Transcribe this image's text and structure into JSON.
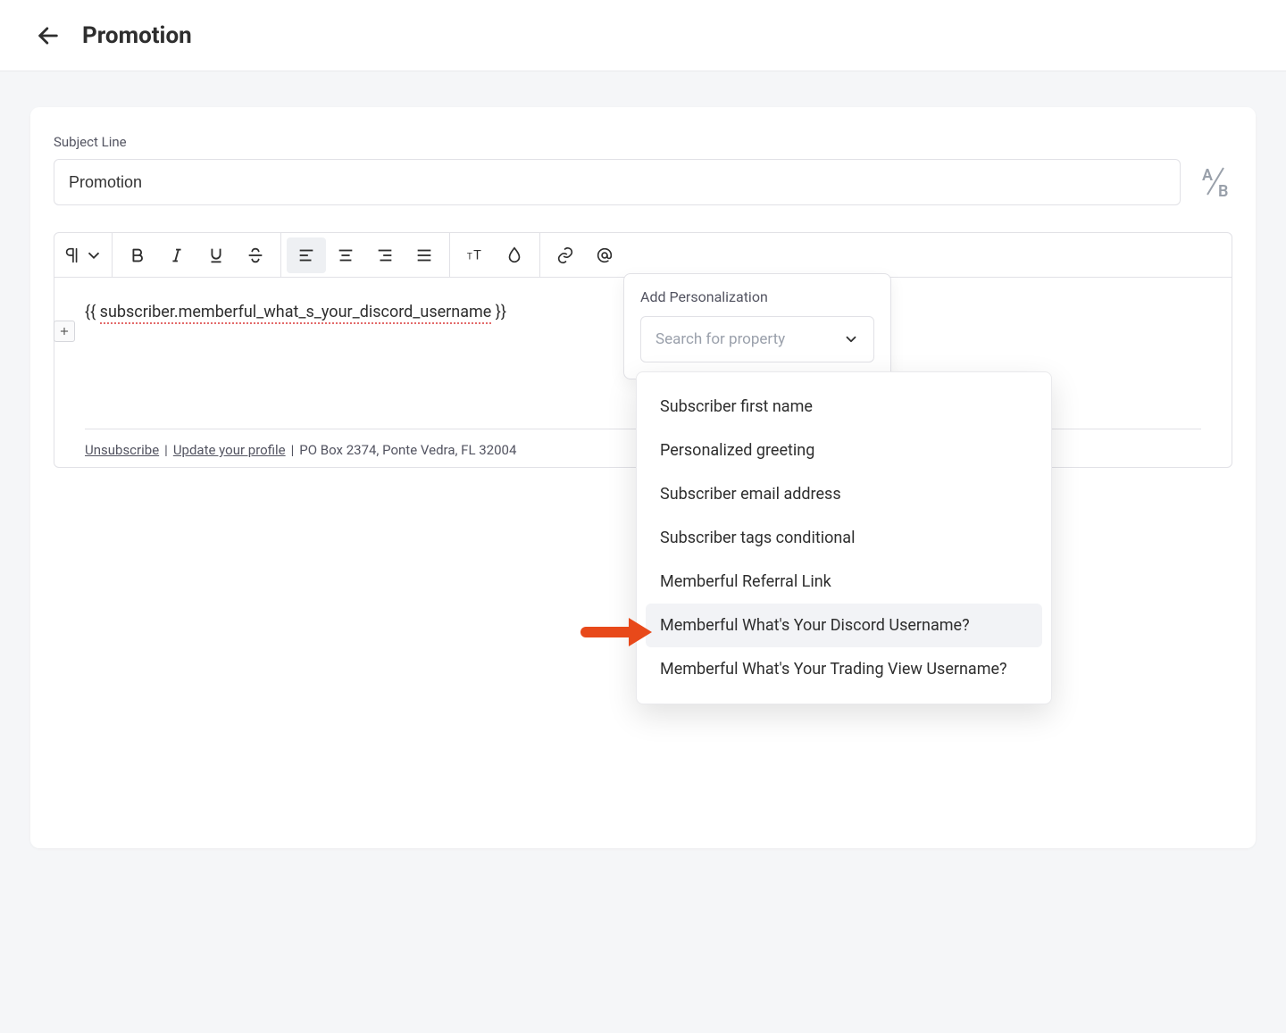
{
  "header": {
    "title": "Promotion"
  },
  "subject": {
    "label": "Subject Line",
    "value": "Promotion"
  },
  "editor": {
    "template_var": "subscriber.memberful_what_s_your_discord_username",
    "footer": {
      "unsubscribe": "Unsubscribe",
      "update_profile": "Update your profile",
      "address": "PO Box 2374, Ponte Vedra, FL 32004"
    }
  },
  "personalization": {
    "title": "Add Personalization",
    "placeholder": "Search for property",
    "options": [
      "Subscriber first name",
      "Personalized greeting",
      "Subscriber email address",
      "Subscriber tags conditional",
      "Memberful Referral Link",
      "Memberful What's Your Discord Username?",
      "Memberful What's Your Trading View Username?"
    ],
    "highlighted_index": 5
  }
}
